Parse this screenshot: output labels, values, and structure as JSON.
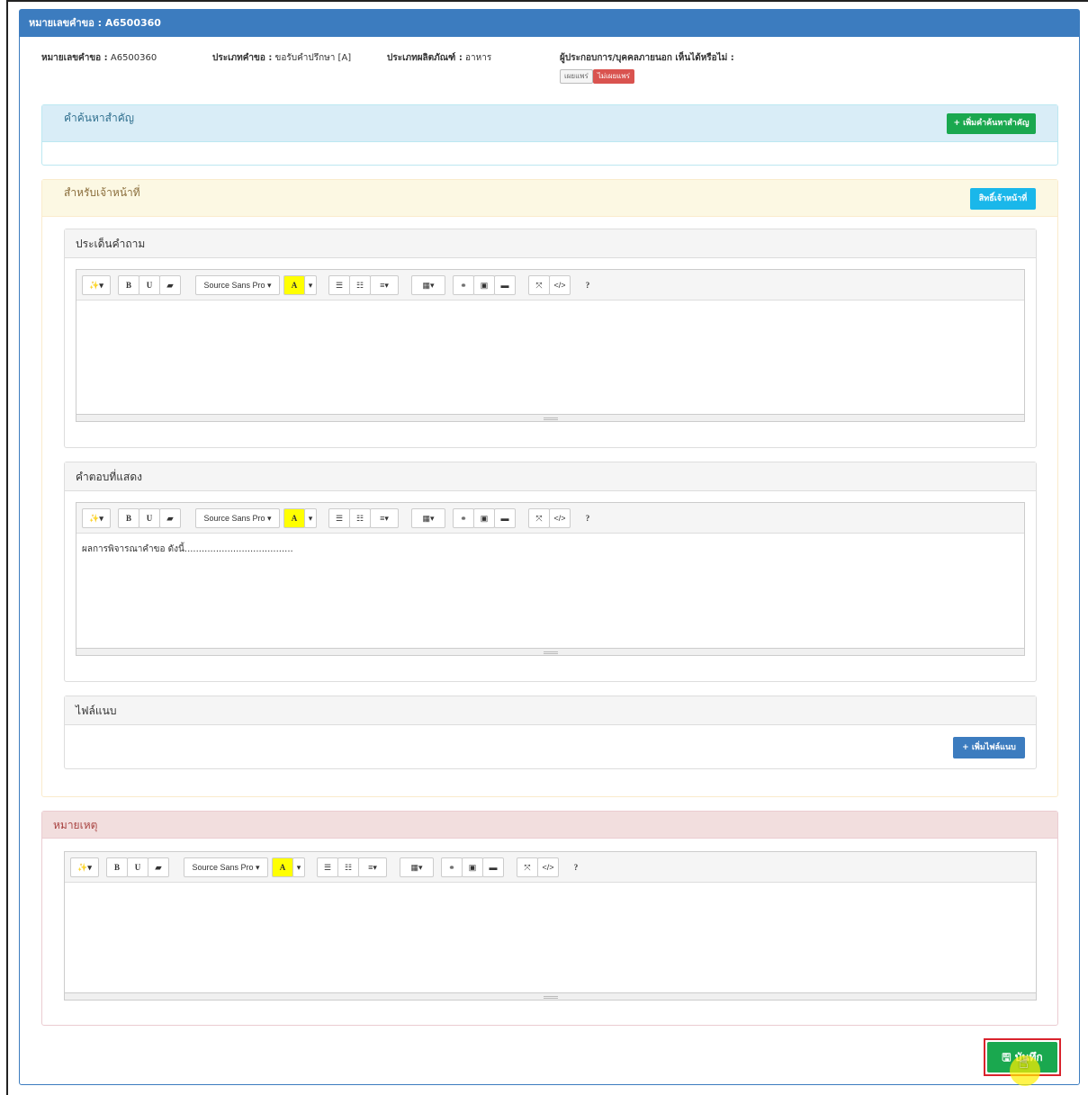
{
  "header": {
    "title": "หมายเลขคำขอ : A6500360"
  },
  "meta": {
    "request_no_label": "หมายเลขคำขอ :",
    "request_no": "A6500360",
    "request_type_label": "ประเภทคำขอ :",
    "request_type": "ขอรับคำปรึกษา [A]",
    "product_type_label": "ประเภทผลิตภัณฑ์ :",
    "product_type": "อาหาร",
    "visibility_label": "ผู้ประกอบการ/บุคคลภายนอก เห็นได้หรือไม่ :",
    "publish": "เผยแพร่",
    "not_publish": "ไม่เผยแพร่"
  },
  "keywords": {
    "title": "คำค้นหาสำคัญ",
    "add_button": "+ เพิ่มคำค้นหาสำคัญ"
  },
  "officer": {
    "title": "สำหรับเจ้าหน้าที่",
    "rights_button": "สิทธิ์เจ้าหน้าที่",
    "question": {
      "title": "ประเด็นคำถาม",
      "content": ""
    },
    "answer": {
      "title": "คำตอบที่แสดง",
      "content": "ผลการพิจารณาคำขอ ดังนี้......................................"
    },
    "attachments": {
      "title": "ไฟล์แนบ",
      "add_button": "+ เพิ่มไฟล์แนบ"
    }
  },
  "remarks": {
    "title": "หมายเหตุ",
    "content": ""
  },
  "toolbar": {
    "magic": "✨▾",
    "bold": "B",
    "underline": "U",
    "eraser": "▰",
    "font": "Source Sans Pro ▾",
    "color": "A",
    "caret": "▾",
    "ul": "☰",
    "ol": "☷",
    "align": "≡▾",
    "table": "▦▾",
    "link": "⚭",
    "picture": "▣",
    "video": "▬",
    "fullscreen": "⤧",
    "code": "</>",
    "help": "?"
  },
  "save_button": "🖫 บันทึก",
  "colors": {
    "primary": "#3c7cbf",
    "success": "#1aa84f",
    "info": "#1ab7ea",
    "danger": "#d9534f"
  }
}
